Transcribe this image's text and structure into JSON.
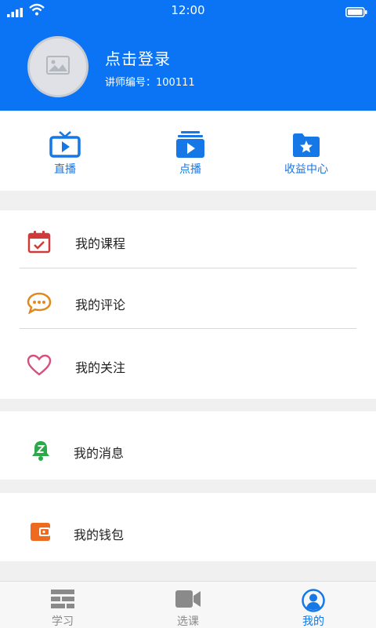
{
  "status_bar": {
    "time": "12:00"
  },
  "profile": {
    "login_prompt": "点击登录",
    "teacher_id": "讲师编号：100111"
  },
  "quick_actions": [
    {
      "label": "直播",
      "icon": "tv-icon"
    },
    {
      "label": "点播",
      "icon": "video-stack-icon"
    },
    {
      "label": "收益中心",
      "icon": "folder-star-icon"
    }
  ],
  "menu_group_1": [
    {
      "label": "我的课程",
      "icon": "calendar-check-icon"
    },
    {
      "label": "我的评论",
      "icon": "chat-bubble-icon"
    },
    {
      "label": "我的关注",
      "icon": "heart-icon"
    }
  ],
  "menu_messages": {
    "label": "我的消息",
    "icon": "bell-icon"
  },
  "menu_wallet": {
    "label": "我的钱包",
    "icon": "wallet-icon"
  },
  "tab_bar": [
    {
      "label": "学习",
      "icon": "list-icon"
    },
    {
      "label": "选课",
      "icon": "video-camera-icon"
    },
    {
      "label": "我的",
      "icon": "user-icon",
      "active": true
    }
  ],
  "colors": {
    "brand": "#0a74f5",
    "accent": "#1677e6"
  }
}
